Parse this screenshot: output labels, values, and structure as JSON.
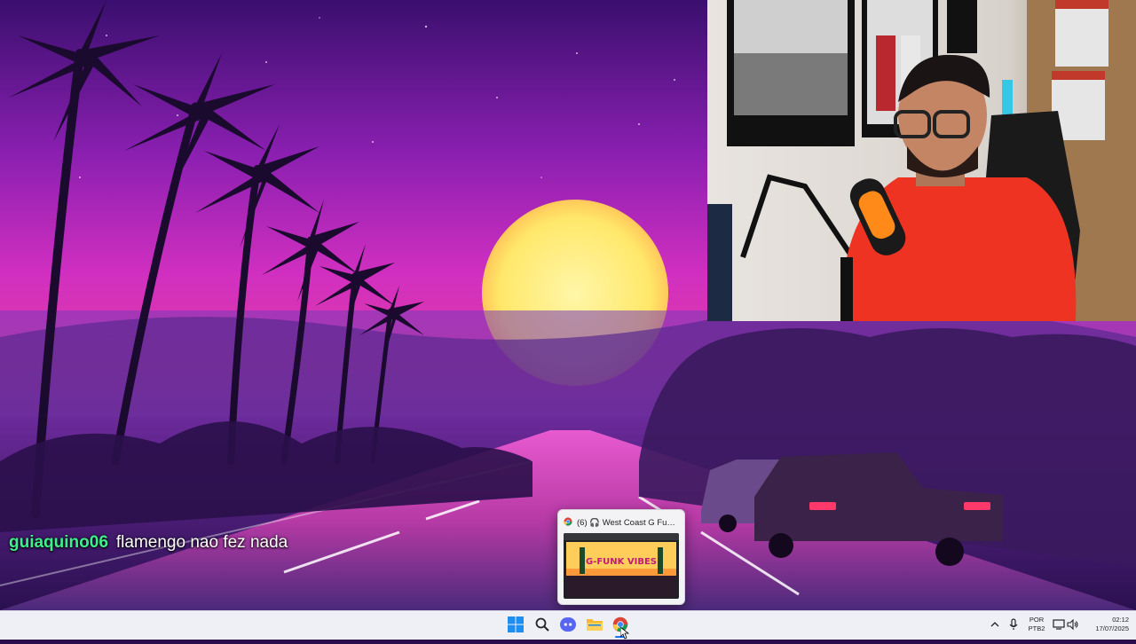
{
  "chat": {
    "username": "guiaquino06",
    "message": "flamengo nao fez nada"
  },
  "preview": {
    "tab_title": "(6) 🎧 West Coast G Funk...",
    "thumb_text": "G-FUNK VIBES"
  },
  "taskbar": {
    "icons": [
      "windows-start-icon",
      "search-icon",
      "discord-icon",
      "file-explorer-icon",
      "chrome-icon"
    ],
    "language_line1": "POR",
    "language_line2": "PTB2",
    "time": "02:12",
    "date": "17/07/2025"
  },
  "colors": {
    "chat_username": "#3df08a",
    "taskbar_bg": "#eef0f6",
    "accent": "#1a73e8"
  }
}
